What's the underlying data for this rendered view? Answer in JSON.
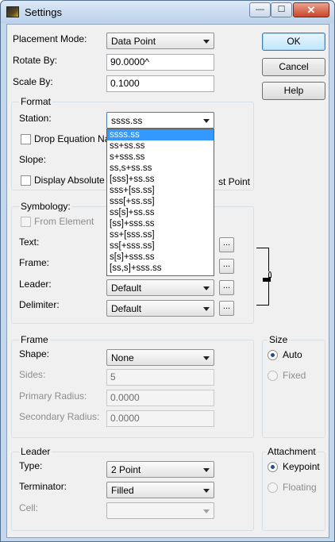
{
  "window": {
    "title": "Settings",
    "minimize_glyph": "—",
    "maximize_glyph": "☐",
    "close_glyph": "✕"
  },
  "main": {
    "placement_mode_label": "Placement Mode:",
    "placement_mode_value": "Data Point",
    "rotate_by_label": "Rotate By:",
    "rotate_by_value": "90.0000^",
    "scale_by_label": "Scale By:",
    "scale_by_value": "0.1000"
  },
  "buttons": {
    "ok": "OK",
    "cancel": "Cancel",
    "help": "Help"
  },
  "format": {
    "title": "Format",
    "station_label": "Station:",
    "station_value": "ssss.ss",
    "drop_equation_label": "Drop Equation Na",
    "slope_label": "Slope:",
    "display_absolute_label": "Display Absolute",
    "first_point_tail": "st Point",
    "station_options": [
      "ssss.ss",
      "ss+ss.ss",
      "s+sss.ss",
      "ss,s+ss.ss",
      "[sss]+ss.ss",
      "sss+[ss.ss]",
      "sss[+ss.ss]",
      "ss[s]+ss.ss",
      "[ss]+sss.ss",
      "ss+[sss.ss]",
      "ss[+sss.ss]",
      "s[s]+sss.ss",
      "[ss,s]+sss.ss"
    ],
    "selected_option_index": 0
  },
  "symbology": {
    "title": "Symbology:",
    "from_element_label": "From Element",
    "text_label": "Text:",
    "frame_label": "Frame:",
    "leader_label": "Leader:",
    "leader_value": "Default",
    "delimiter_label": "Delimiter:",
    "delimiter_value": "Default",
    "browse_label": "..."
  },
  "frame": {
    "title": "Frame",
    "shape_label": "Shape:",
    "shape_value": "None",
    "sides_label": "Sides:",
    "sides_value": "5",
    "primary_radius_label": "Primary Radius:",
    "primary_radius_value": "0.0000",
    "secondary_radius_label": "Secondary Radius:",
    "secondary_radius_value": "0.0000"
  },
  "size": {
    "title": "Size",
    "auto_label": "Auto",
    "fixed_label": "Fixed"
  },
  "leader": {
    "title": "Leader",
    "type_label": "Type:",
    "type_value": "2 Point",
    "terminator_label": "Terminator:",
    "terminator_value": "Filled",
    "cell_label": "Cell:",
    "cell_value": ""
  },
  "attachment": {
    "title": "Attachment",
    "keypoint_label": "Keypoint",
    "floating_label": "Floating"
  }
}
